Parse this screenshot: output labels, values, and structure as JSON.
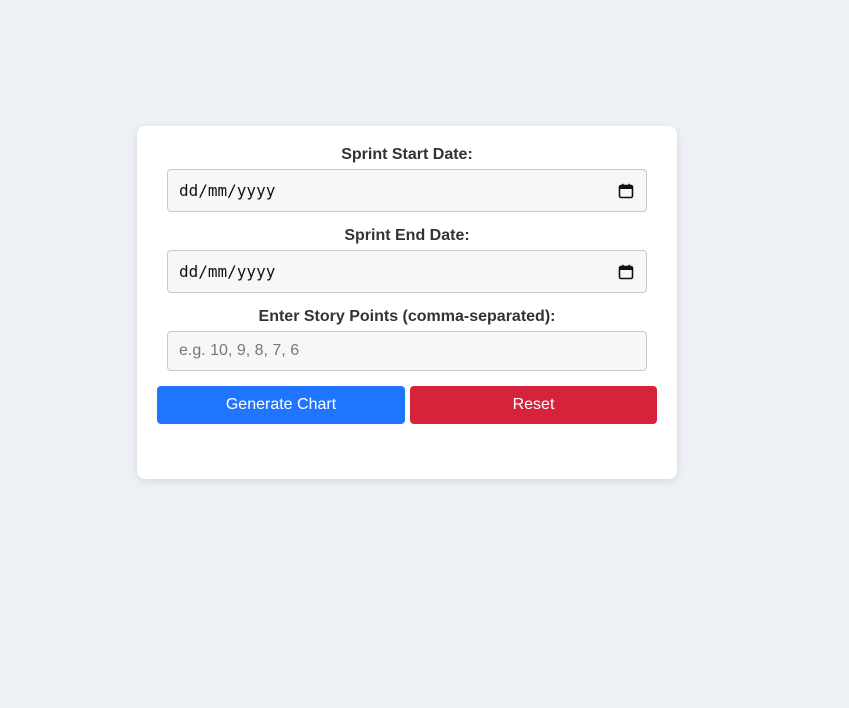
{
  "form": {
    "start_date": {
      "label": "Sprint Start Date:",
      "value": "dd/mm/yyyy",
      "icon": "calendar-icon"
    },
    "end_date": {
      "label": "Sprint End Date:",
      "value": "dd/mm/yyyy",
      "icon": "calendar-icon"
    },
    "story_points": {
      "label": "Enter Story Points (comma-separated):",
      "value": "",
      "placeholder": "e.g. 10, 9, 8, 7, 6"
    }
  },
  "buttons": {
    "generate_label": "Generate Chart",
    "reset_label": "Reset"
  },
  "colors": {
    "page_background": "#edf0f5",
    "card_background": "#ffffff",
    "generate_button": "#1f75fe",
    "reset_button": "#d6233b",
    "input_background": "#f7f7f7"
  }
}
